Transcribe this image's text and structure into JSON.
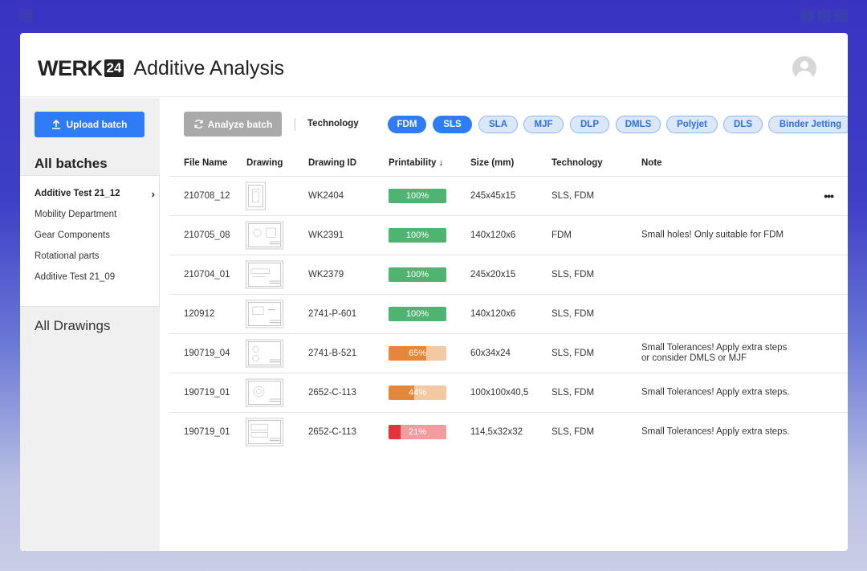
{
  "brand": {
    "name": "WERK",
    "badge": "24",
    "app_title": "Additive Analysis"
  },
  "sidebar": {
    "upload_label": "Upload batch",
    "batches_heading": "All batches",
    "items": [
      {
        "label": "Additive Test 21_12",
        "active": true
      },
      {
        "label": "Mobility Department"
      },
      {
        "label": "Gear Components"
      },
      {
        "label": "Rotational parts"
      },
      {
        "label": "Additive Test 21_09"
      }
    ],
    "drawings_heading": "All Drawings"
  },
  "toolbar": {
    "analyze_label": "Analyze batch",
    "technology_label": "Technology",
    "chips": [
      {
        "label": "FDM",
        "active": true
      },
      {
        "label": "SLS",
        "active": true
      },
      {
        "label": "SLA"
      },
      {
        "label": "MJF"
      },
      {
        "label": "DLP"
      },
      {
        "label": "DMLS"
      },
      {
        "label": "Polyjet"
      },
      {
        "label": "DLS"
      },
      {
        "label": "Binder Jetting"
      }
    ]
  },
  "table": {
    "headers": {
      "file_name": "File Name",
      "drawing": "Drawing",
      "drawing_id": "Drawing ID",
      "printability": "Printability ↓",
      "size": "Size (mm)",
      "technology": "Technology",
      "note": "Note"
    },
    "rows": [
      {
        "file": "210708_12",
        "id": "WK2404",
        "pct": 100,
        "pct_label": "100%",
        "size": "245x45x15",
        "tech": "SLS, FDM",
        "note": "",
        "note2": "",
        "status": "good",
        "more": "•••"
      },
      {
        "file": "210705_08",
        "id": "WK2391",
        "pct": 100,
        "pct_label": "100%",
        "size": "140x120x6",
        "tech": "FDM",
        "note": "Small holes! Only suitable for FDM",
        "note2": "",
        "status": "good"
      },
      {
        "file": "210704_01",
        "id": "WK2379",
        "pct": 100,
        "pct_label": "100%",
        "size": "245x20x15",
        "tech": "SLS, FDM",
        "note": "",
        "note2": "",
        "status": "good"
      },
      {
        "file": "120912",
        "id": "2741-P-601",
        "pct": 100,
        "pct_label": "100%",
        "size": "140x120x6",
        "tech": "SLS, FDM",
        "note": "",
        "note2": "",
        "status": "good"
      },
      {
        "file": "190719_04",
        "id": "2741-B-521",
        "pct": 65,
        "pct_label": "65%",
        "size": "60x34x24",
        "tech": "SLS, FDM",
        "note": "Small Tolerances! Apply extra steps",
        "note2": "or consider DMLS or MJF",
        "status": "warn"
      },
      {
        "file": "190719_01",
        "id": "2652-C-113",
        "pct": 44,
        "pct_label": "44%",
        "size": "100x100x40,5",
        "tech": "SLS, FDM",
        "note": "Small Tolerances! Apply extra steps.",
        "note2": "",
        "status": "warn"
      },
      {
        "file": "190719_01",
        "id": "2652-C-113",
        "pct": 21,
        "pct_label": "21%",
        "size": "114,5x32x32",
        "tech": "SLS, FDM",
        "note": "Small Tolerances! Apply extra steps.",
        "note2": "",
        "status": "bad"
      }
    ]
  },
  "colors": {
    "accent": "#2f7cf6",
    "good": "#4fb472",
    "warn_fill": "#e3873a",
    "warn_track": "#f2c9a0",
    "bad_fill": "#e8313c",
    "bad_track": "#f49ba0"
  }
}
